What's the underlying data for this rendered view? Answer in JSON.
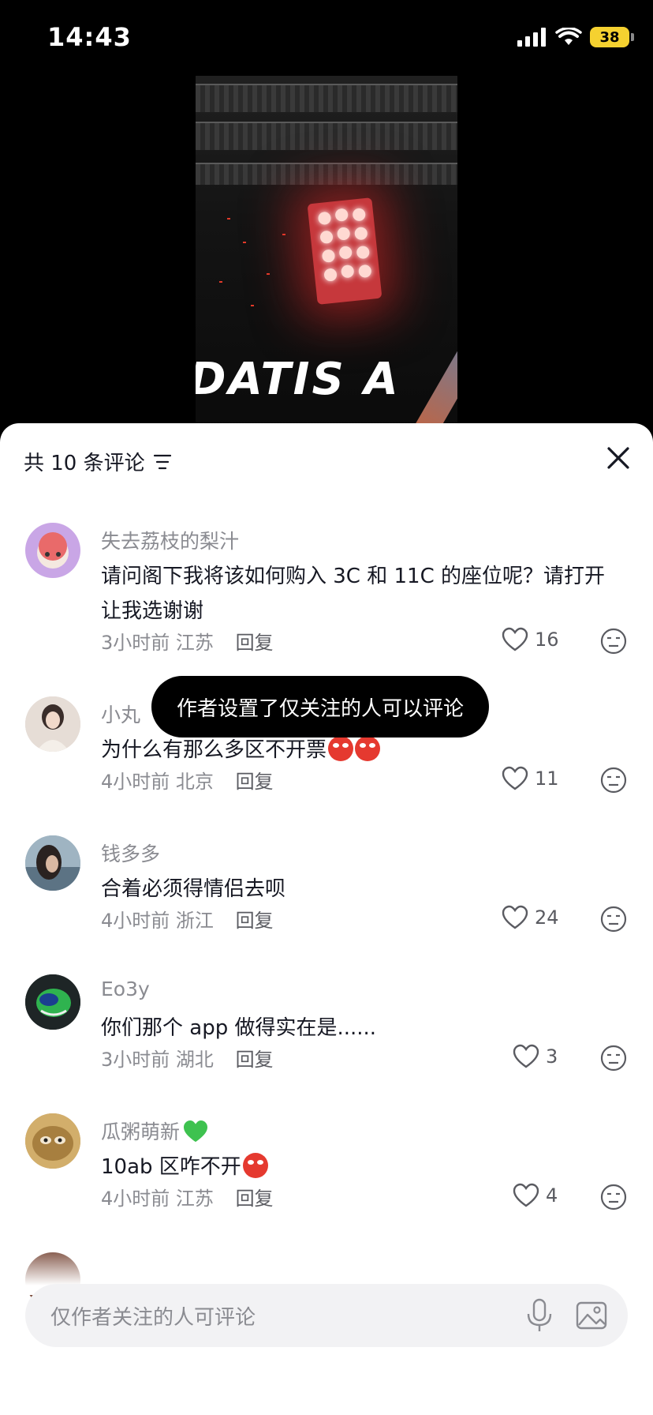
{
  "status_bar": {
    "time": "14:43",
    "battery": "38"
  },
  "video": {
    "overlay_text": "DATIS A"
  },
  "comments_sheet": {
    "title": "共 10 条评论",
    "toast": "作者设置了仅关注的人可以评论",
    "comments": [
      {
        "name": "失去荔枝的梨汁",
        "text": "请问阁下我将该如何购入 3C 和 11C 的座位呢？请打开让我选谢谢",
        "time": "3小时前",
        "location": "江苏",
        "reply": "回复",
        "likes": "16"
      },
      {
        "name": "小丸",
        "text": "为什么有那么多区不开票",
        "time": "4小时前",
        "location": "北京",
        "reply": "回复",
        "likes": "11"
      },
      {
        "name": "钱多多",
        "text": "合着必须得情侣去呗",
        "time": "4小时前",
        "location": "浙江",
        "reply": "回复",
        "likes": "24"
      },
      {
        "name": "Eo3y",
        "text": "你们那个 app 做得实在是......",
        "time": "3小时前",
        "location": "湖北",
        "reply": "回复",
        "likes": "3"
      },
      {
        "name": "瓜粥萌新",
        "text": "10ab 区咋不开",
        "time": "4小时前",
        "location": "江苏",
        "reply": "回复",
        "likes": "4"
      }
    ],
    "input_placeholder": "仅作者关注的人可评论"
  },
  "colors": {
    "accent_battery": "#f5d130",
    "like_icon": "#5a5b61",
    "toast_bg": "#000000"
  }
}
